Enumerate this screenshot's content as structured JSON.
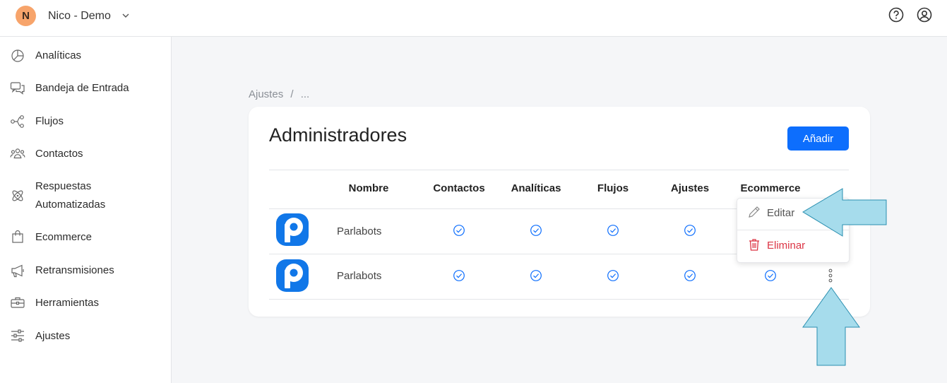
{
  "header": {
    "avatar_initial": "N",
    "org_name": "Nico - Demo",
    "icons": [
      "chevron-down-icon",
      "help-icon",
      "user-circle-icon"
    ]
  },
  "sidebar": {
    "items": [
      {
        "label": "Analíticas",
        "icon": "pie-chart-icon"
      },
      {
        "label": "Bandeja de Entrada",
        "icon": "chat-bubbles-icon"
      },
      {
        "label": "Flujos",
        "icon": "flow-icon"
      },
      {
        "label": "Contactos",
        "icon": "people-icon"
      },
      {
        "label": "Respuestas",
        "label2": "Automatizadas",
        "icon": "atom-icon"
      },
      {
        "label": "Ecommerce",
        "icon": "bag-icon"
      },
      {
        "label": "Retransmisiones",
        "icon": "megaphone-icon"
      },
      {
        "label": "Herramientas",
        "icon": "toolbox-icon"
      },
      {
        "label": "Ajustes",
        "icon": "sliders-icon"
      }
    ]
  },
  "breadcrumb": {
    "root": "Ajustes",
    "separator": "/",
    "current": "..."
  },
  "card": {
    "title": "Administradores",
    "add_label": "Añadir"
  },
  "table": {
    "columns": [
      "Nombre",
      "Contactos",
      "Analíticas",
      "Flujos",
      "Ajustes",
      "Ecommerce"
    ],
    "rows": [
      {
        "name": "Parlabots",
        "contactos": true,
        "analiticas": true,
        "flujos": true,
        "ajustes": true,
        "ecommerce": true
      },
      {
        "name": "Parlabots",
        "contactos": true,
        "analiticas": true,
        "flujos": true,
        "ajustes": true,
        "ecommerce": true
      }
    ]
  },
  "menu": {
    "edit_label": "Editar",
    "delete_label": "Eliminar"
  },
  "colors": {
    "accent": "#0d6efd",
    "avatar": "#f7a46b",
    "danger": "#dc3545",
    "check": "#0d6efd",
    "annotation_arrow": "#a6dcec"
  }
}
